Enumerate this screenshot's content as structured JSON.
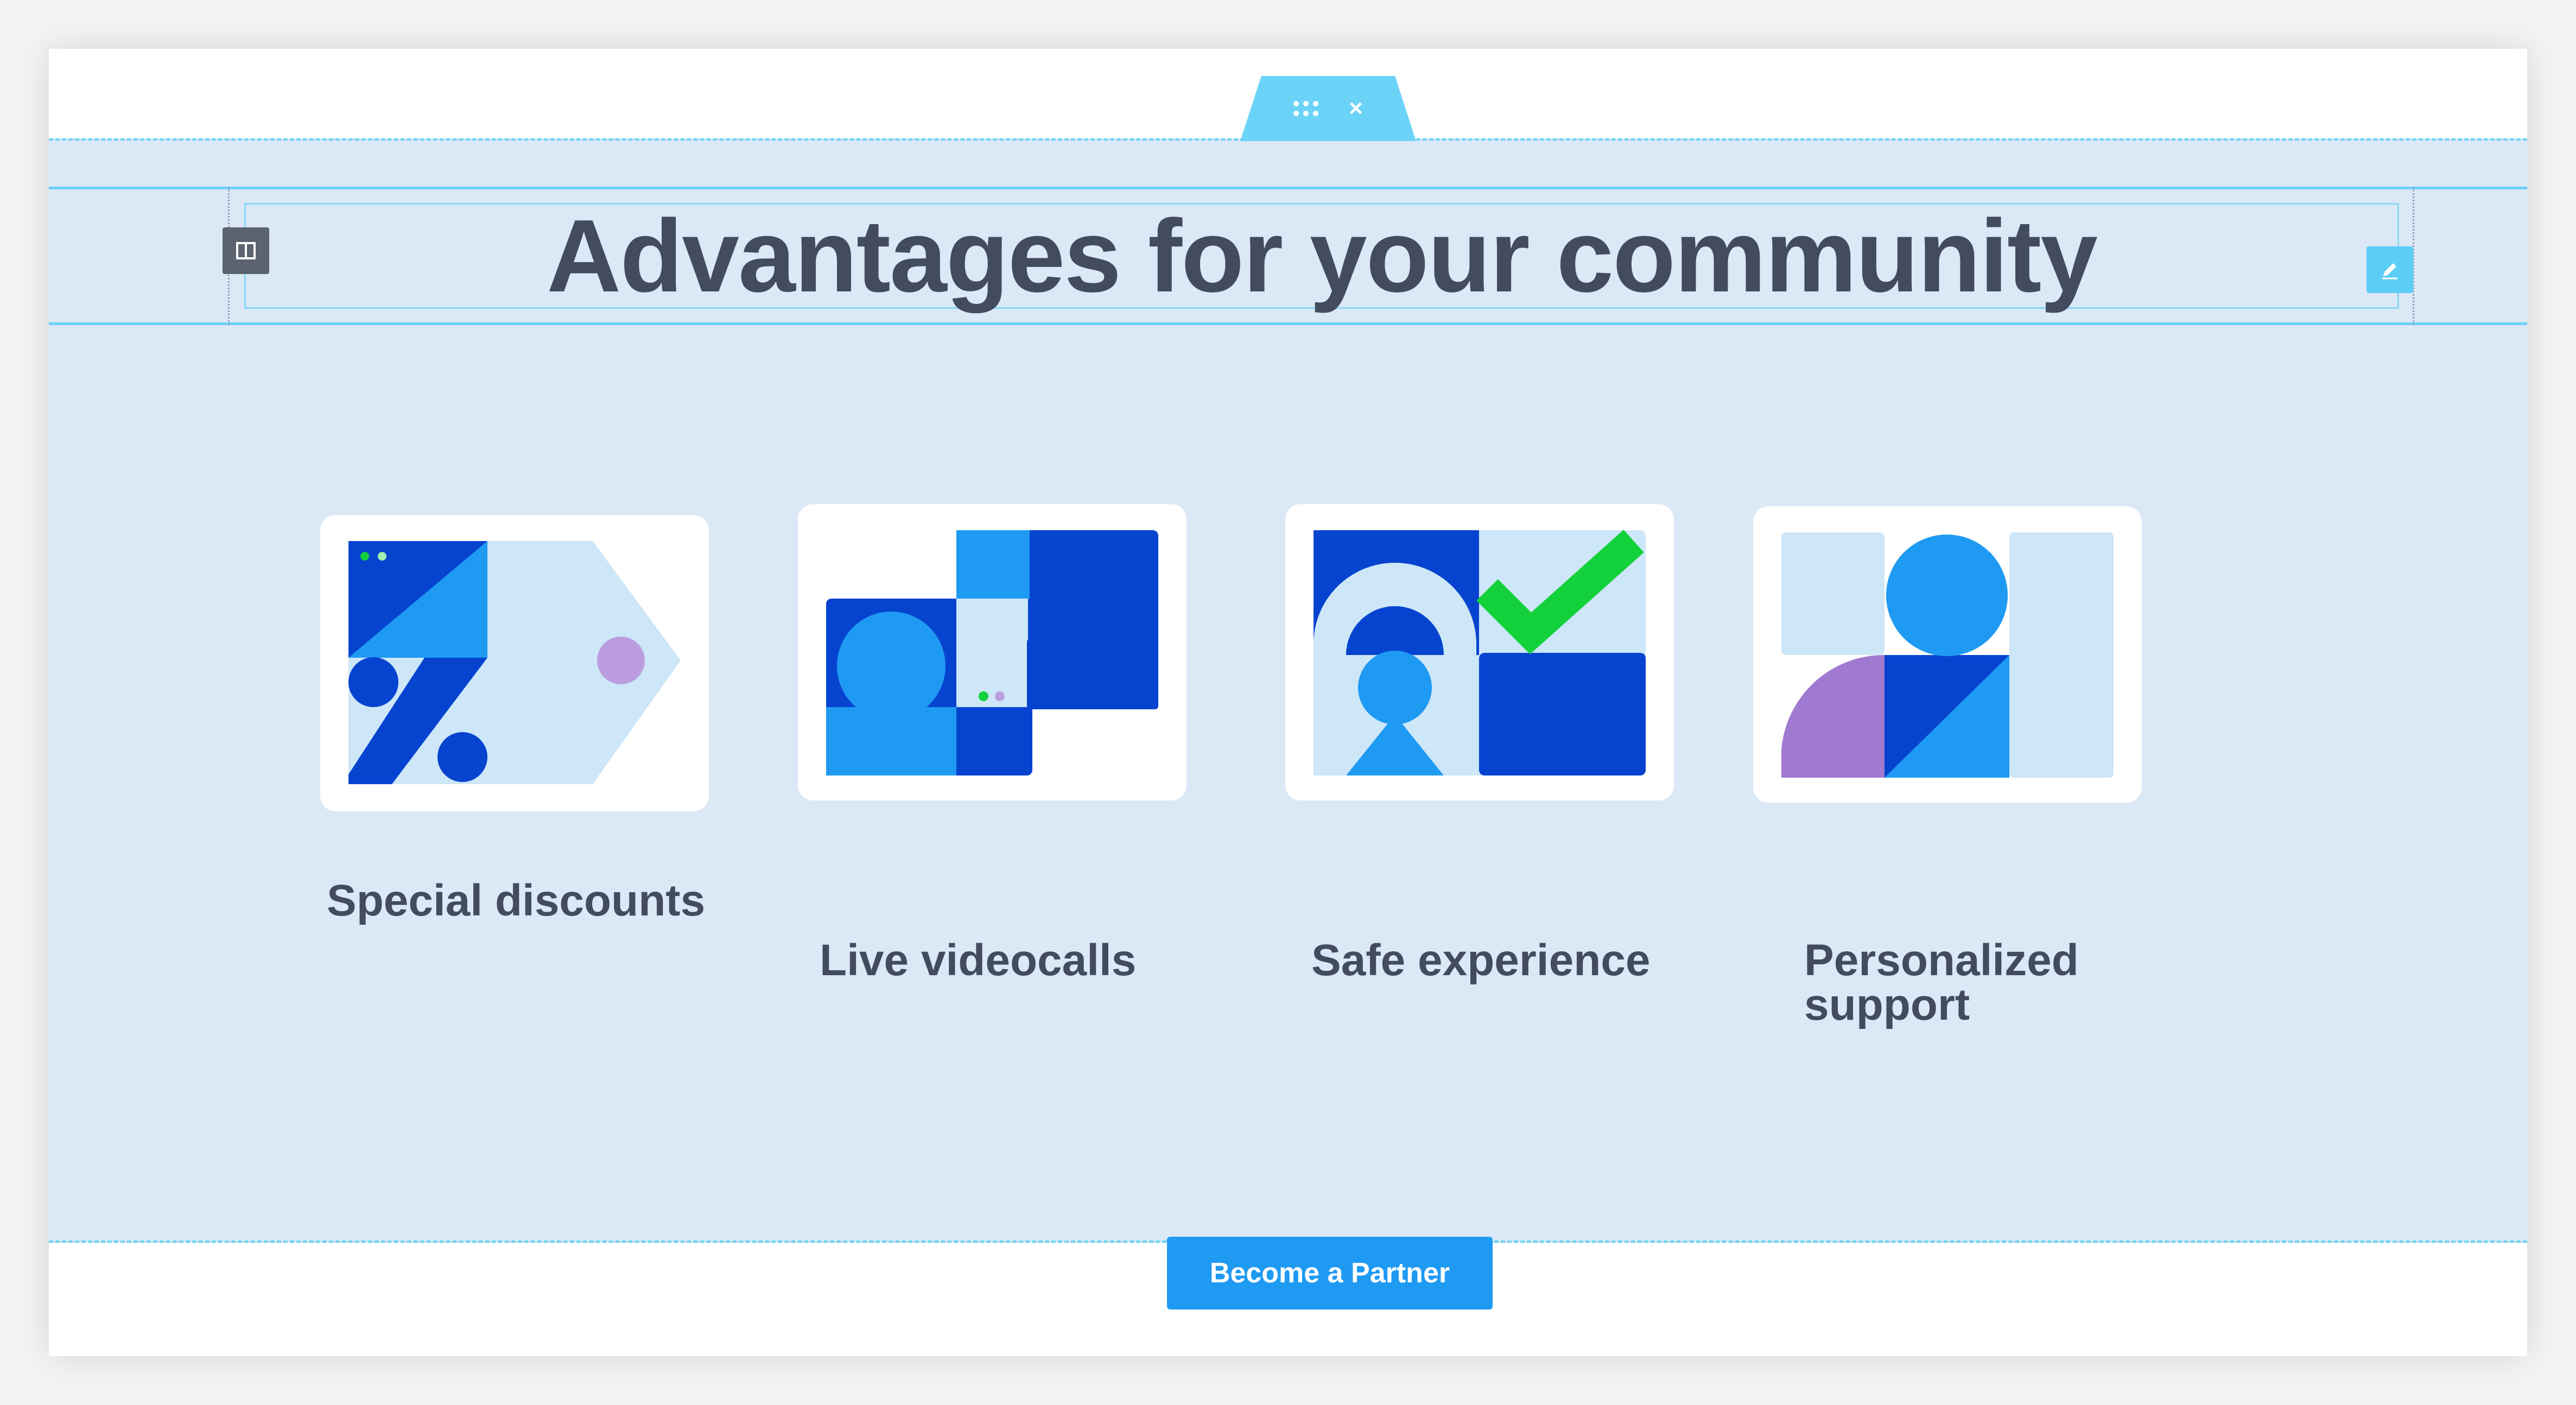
{
  "section": {
    "heading": "Advantages for your community",
    "handle_close": "×"
  },
  "features": [
    {
      "label": "Special discounts"
    },
    {
      "label": "Live videocalls"
    },
    {
      "label": "Safe experience"
    },
    {
      "label": "Personalized\nsupport"
    }
  ],
  "cta": {
    "label": "Become a Partner"
  },
  "colors": {
    "section_bg": "#dbe8f6",
    "heading_text": "#434c5f",
    "selection_outline": "#6ad0f7",
    "button_bg": "#1f9af3",
    "dark_blue": "#0644d0",
    "mid_blue": "#1f9af3",
    "light_blue": "#cde6f8",
    "green": "#13d13b",
    "purple": "#a07ad0"
  },
  "icons": [
    "drag-grip-icon",
    "close-icon",
    "columns-icon",
    "pencil-icon"
  ]
}
